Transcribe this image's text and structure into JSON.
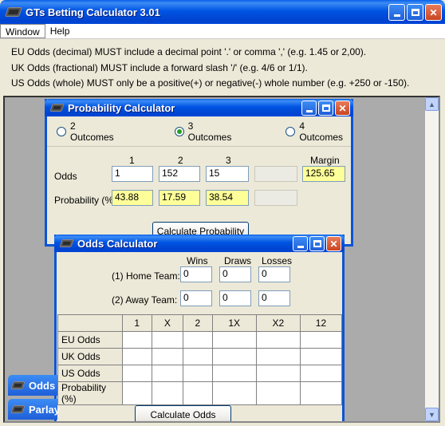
{
  "app": {
    "title": "GTs Betting Calculator  3.01",
    "menu": [
      "Window",
      "Help"
    ],
    "notes": [
      "EU Odds (decimal) MUST include a decimal point '.' or comma ',' (e.g. 1.45 or 2,00).",
      "UK Odds (fractional) MUST include a forward slash '/' (e.g. 4/6 or 1/1).",
      "US Odds (whole) MUST only be a positive(+) or negative(-) whole number (e.g. +250 or -150)."
    ]
  },
  "probability_calculator": {
    "title": "Probability Calculator",
    "outcome_options": [
      "2 Outcomes",
      "3 Outcomes",
      "4 Outcomes"
    ],
    "selected_outcome": "3 Outcomes",
    "col_headers": [
      "1",
      "2",
      "3"
    ],
    "margin_label": "Margin",
    "odds_label": "Odds",
    "odds_values": [
      "1",
      "152",
      "15",
      ""
    ],
    "margin_value": "125.65",
    "probability_label": "Probability (%)",
    "probability_values": [
      "43.88",
      "17.59",
      "38.54",
      ""
    ],
    "calculate_button": "Calculate Probability"
  },
  "odds_calculator": {
    "title": "Odds Calculator",
    "headers": [
      "Wins",
      "Draws",
      "Losses"
    ],
    "home_label": "(1) Home Team:",
    "away_label": "(2) Away Team:",
    "home_values": [
      "0",
      "0",
      "0"
    ],
    "away_values": [
      "0",
      "0",
      "0"
    ],
    "grid_headers": [
      "1",
      "X",
      "2",
      "1X",
      "X2",
      "12"
    ],
    "grid_rows": [
      "EU Odds",
      "UK Odds",
      "US Odds",
      "Probability (%)"
    ],
    "calculate_button": "Calculate Odds"
  },
  "taskbar_tabs": [
    "Odds",
    "Parlay"
  ],
  "colors": {
    "title_blue": "#0054E3",
    "highlight_yellow": "#FFFF99",
    "mdi_gray": "#ABABAB"
  }
}
